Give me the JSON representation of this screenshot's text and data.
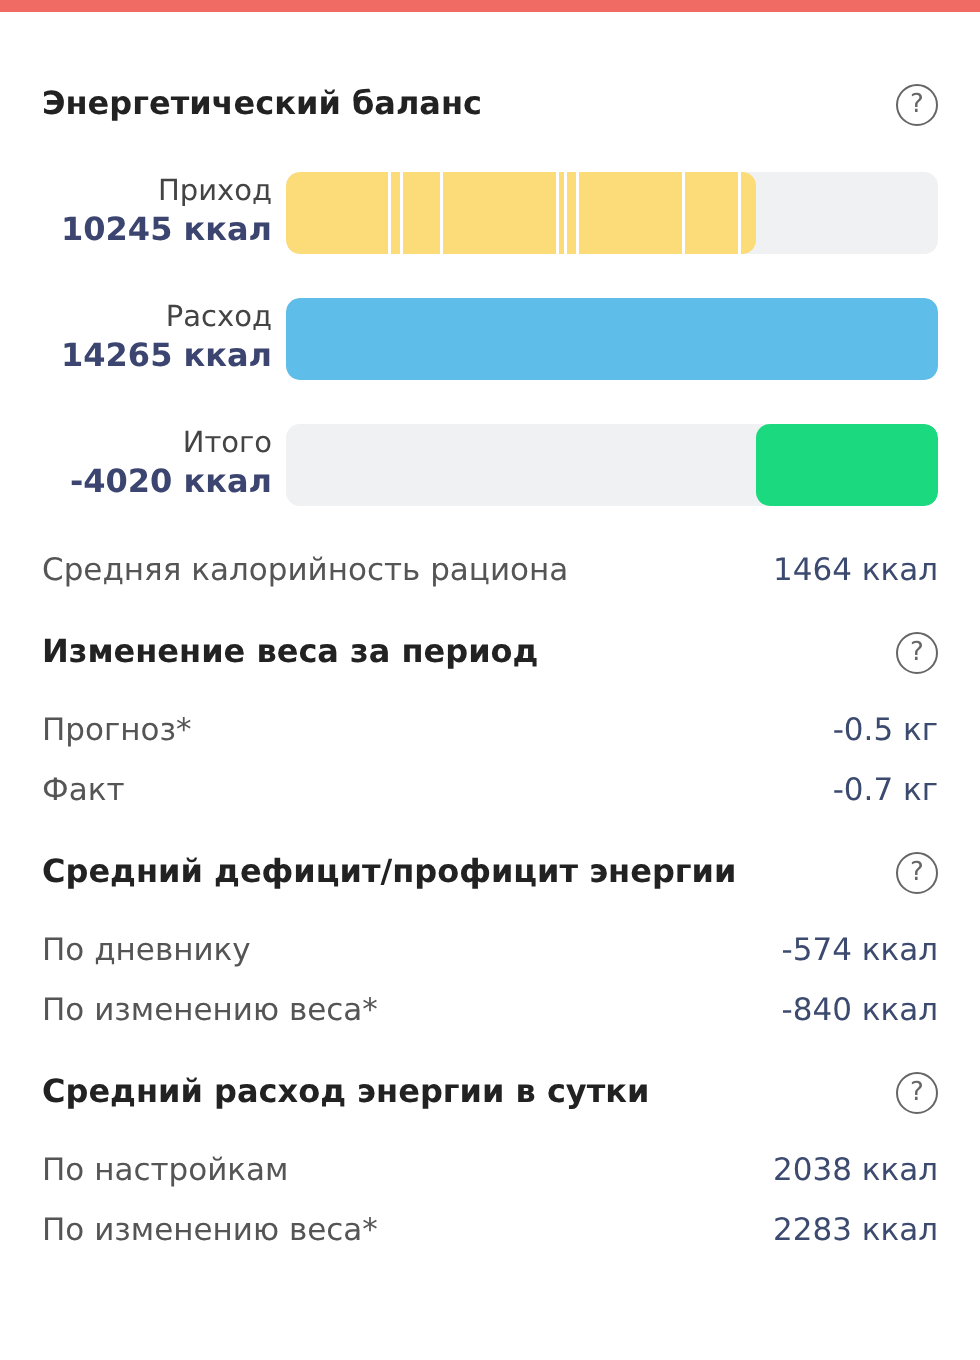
{
  "balance": {
    "title": "Энергетический баланс",
    "help": "?",
    "bars": [
      {
        "label": "Приход",
        "value": "10245 ккал",
        "kind": "segmented",
        "color": "#fcdc78",
        "level": 0.72
      },
      {
        "label": "Расход",
        "value": "14265 ккал",
        "kind": "left",
        "color": "#5ebde9",
        "level": 1
      },
      {
        "label": "Итого",
        "value": "-4020 ккал",
        "kind": "right",
        "color": "#1ad97f",
        "level": 0.28
      }
    ]
  },
  "average": {
    "label": "Средняя калорийность рациона",
    "value": "1464 ккал"
  },
  "sections": [
    {
      "title": "Изменение веса за период",
      "help": "?",
      "rows": [
        {
          "label": "Прогноз*",
          "value": "-0.5 кг"
        },
        {
          "label": "Факт",
          "value": "-0.7 кг"
        }
      ]
    },
    {
      "title": "Средний дефицит/профицит энергии",
      "help": "?",
      "rows": [
        {
          "label": "По дневнику",
          "value": "-574 ккал"
        },
        {
          "label": "По изменению веса*",
          "value": "-840 ккал"
        }
      ]
    },
    {
      "title": "Средний расход энергии в сутки",
      "help": "?",
      "rows": [
        {
          "label": "По настройкам",
          "value": "2038 ккал"
        },
        {
          "label": "По изменению веса*",
          "value": "2283 ккал"
        }
      ]
    }
  ]
}
